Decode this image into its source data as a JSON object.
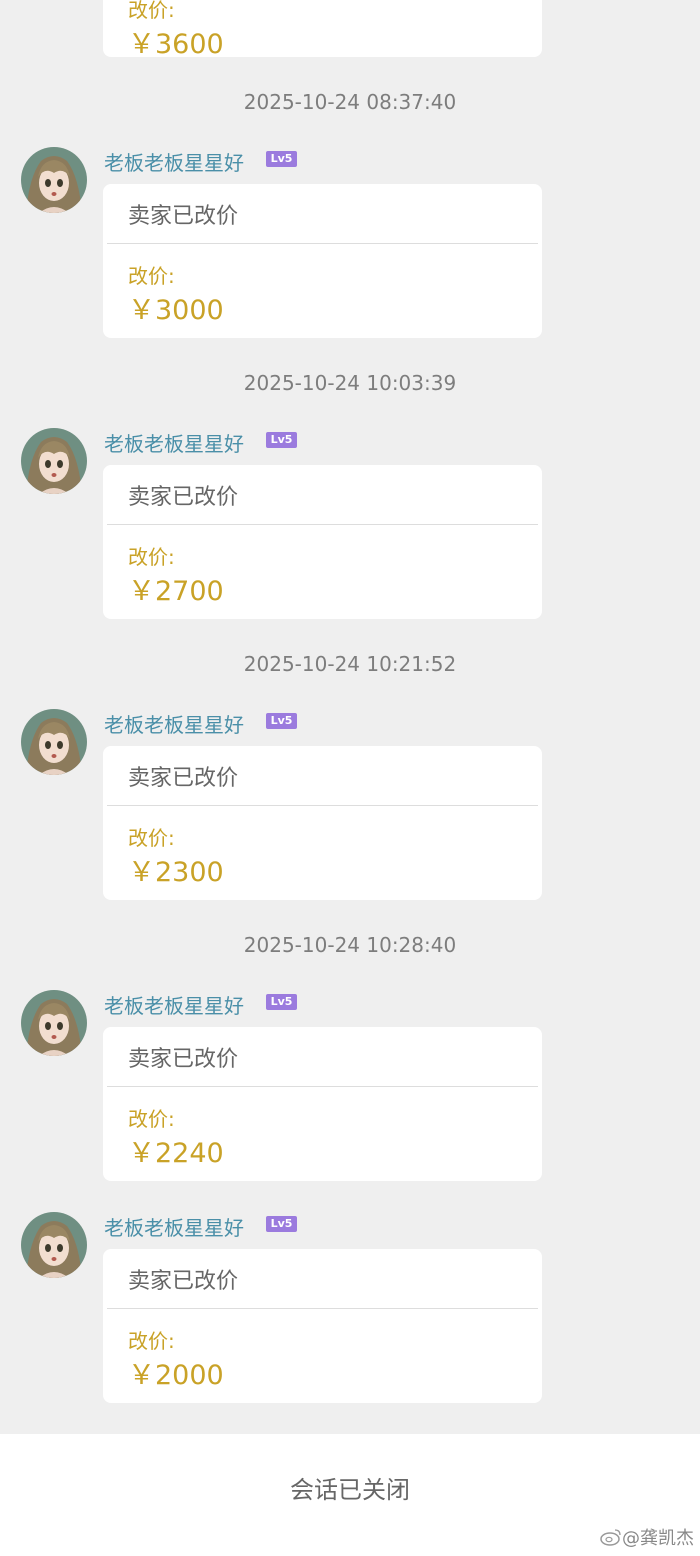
{
  "messages": [
    {
      "sender": "",
      "badge": "",
      "notice": "",
      "price_label": "改价:",
      "price": "￥3600"
    },
    {
      "sender": "老板老板星星好",
      "badge": "Lv5",
      "notice": "卖家已改价",
      "price_label": "改价:",
      "price": "￥3000"
    },
    {
      "sender": "老板老板星星好",
      "badge": "Lv5",
      "notice": "卖家已改价",
      "price_label": "改价:",
      "price": "￥2700"
    },
    {
      "sender": "老板老板星星好",
      "badge": "Lv5",
      "notice": "卖家已改价",
      "price_label": "改价:",
      "price": "￥2300"
    },
    {
      "sender": "老板老板星星好",
      "badge": "Lv5",
      "notice": "卖家已改价",
      "price_label": "改价:",
      "price": "￥2240"
    },
    {
      "sender": "老板老板星星好",
      "badge": "Lv5",
      "notice": "卖家已改价",
      "price_label": "改价:",
      "price": "￥2000"
    }
  ],
  "timestamps": [
    "2025-10-24 08:37:40",
    "2025-10-24 10:03:39",
    "2025-10-24 10:21:52",
    "2025-10-24 10:28:40"
  ],
  "footer": {
    "status": "会话已关闭",
    "watermark": "@龚凯杰"
  },
  "colors": {
    "background": "#efefef",
    "price": "#c9a227",
    "sender_name": "#4a8fa8",
    "level_badge": "#9b7bde"
  },
  "icons": [
    "avatar-image",
    "weibo-logo-icon"
  ]
}
